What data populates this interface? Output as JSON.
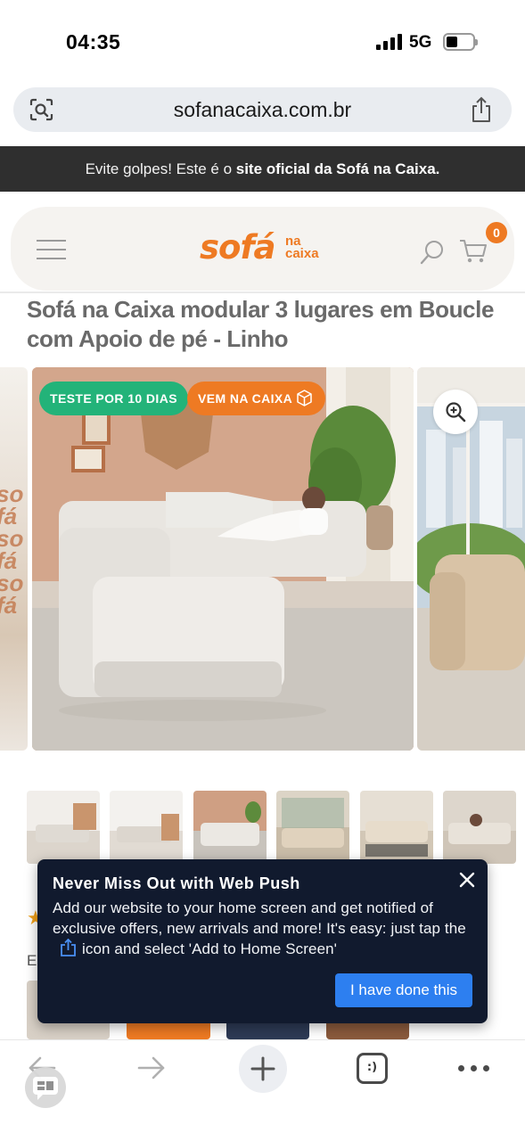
{
  "status_bar": {
    "time": "04:35",
    "network": "5G"
  },
  "browser": {
    "url": "sofanacaixa.com.br"
  },
  "announcement": {
    "prefix": "Evite golpes! Este é o ",
    "bold": "site oficial da Sofá na Caixa."
  },
  "header": {
    "logo_main": "sofá",
    "logo_sub_1": "na",
    "logo_sub_2": "caixa",
    "cart_count": "0"
  },
  "product": {
    "title": "Sofá na Caixa modular 3 lugares em Boucle com Apoio de pé - Linho",
    "badge_trial": "TESTE POR 10 DIAS",
    "badge_box": "VEM NA CAIXA",
    "stub_text": "Es"
  },
  "push_popup": {
    "title": "Never Miss Out with Web Push",
    "body_before": "Add our website to your home screen and get notified of exclusive offers, new arrivals and more! It's easy: just tap the",
    "body_after": "icon and select 'Add to Home Screen'",
    "button": "I have done this"
  },
  "toolbar": {
    "tabs_label": ":)"
  },
  "colors": {
    "brand_orange": "#ee7a23",
    "badge_green": "#23b379",
    "popup_bg": "#111a2e",
    "popup_button": "#2d7ff0"
  },
  "icons": [
    "camera-search-icon",
    "share-icon",
    "menu-icon",
    "search-icon",
    "cart-icon",
    "box-icon",
    "zoom-icon",
    "close-icon",
    "back-icon",
    "forward-icon",
    "plus-icon",
    "tabs-icon",
    "more-icon",
    "chat-icon"
  ]
}
